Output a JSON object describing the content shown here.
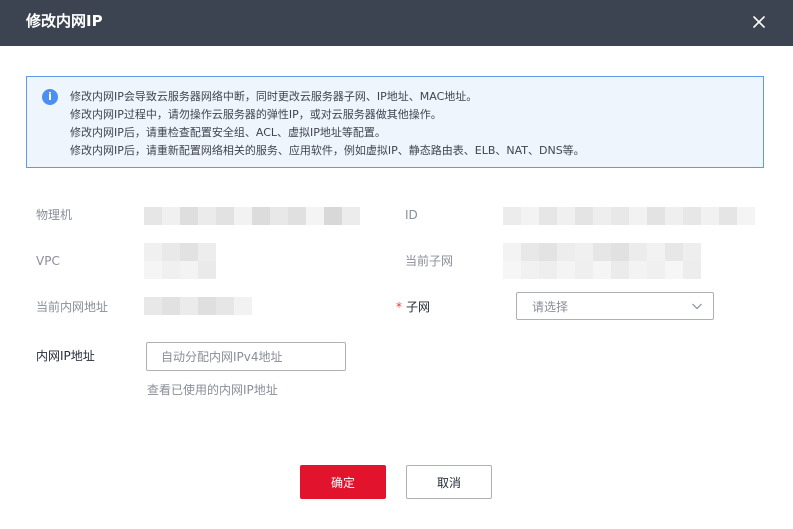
{
  "dialog": {
    "title": "修改内网IP",
    "close_icon": "close-icon"
  },
  "notice": {
    "icon": "info-icon",
    "icon_glyph": "i",
    "lines": [
      "修改内网IP会导致云服务器网络中断，同时更改云服务器子网、IP地址、MAC地址。",
      "修改内网IP过程中，请勿操作云服务器的弹性IP，或对云服务器做其他操作。",
      "修改内网IP后，请重检查配置安全组、ACL、虚拟IP地址等配置。",
      "修改内网IP后，请重新配置网络相关的服务、应用软件，例如虚拟IP、静态路由表、ELB、NAT、DNS等。"
    ]
  },
  "fields": {
    "physical_label": "物理机",
    "id_label": "ID",
    "vpc_label": "VPC",
    "current_subnet_label": "当前子网",
    "current_ip_label": "当前内网地址",
    "subnet_label": "子网",
    "subnet_required_mark": "*",
    "subnet_placeholder": "请选择",
    "ip_label": "内网IP地址",
    "ip_placeholder": "自动分配内网IPv4地址",
    "used_ip_link": "查看已使用的内网IP地址"
  },
  "buttons": {
    "confirm": "确定",
    "cancel": "取消"
  },
  "colors": {
    "header_bg": "#3c4452",
    "primary": "#e2142d",
    "info": "#4b8ff2",
    "notice_border": "#5e9ae8",
    "notice_bg": "#eef5fd"
  }
}
